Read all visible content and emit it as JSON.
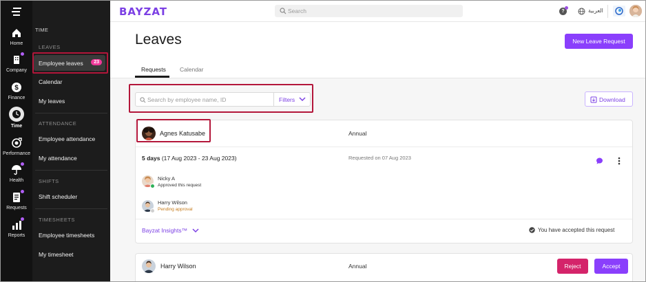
{
  "brand": {
    "logo": "BAYZAT",
    "accent": "#8a3ffc",
    "highlight": "#b3163a"
  },
  "topbar": {
    "search_placeholder": "Search",
    "help_label": "?",
    "language_label": "العربية",
    "icons": [
      "menu-icon",
      "search-icon",
      "help-icon",
      "globe-icon",
      "company-logo",
      "user-avatar"
    ]
  },
  "rail": {
    "items": [
      {
        "label": "Home",
        "icon": "home-icon"
      },
      {
        "label": "Company",
        "icon": "building-icon"
      },
      {
        "label": "Finance",
        "icon": "dollar-icon"
      },
      {
        "label": "Time",
        "icon": "clock-icon"
      },
      {
        "label": "Performance",
        "icon": "target-icon"
      },
      {
        "label": "Health",
        "icon": "umbrella-icon"
      },
      {
        "label": "Requests",
        "icon": "document-icon"
      },
      {
        "label": "Reports",
        "icon": "chart-icon"
      }
    ]
  },
  "sidebar": {
    "title": "TIME",
    "sections": [
      {
        "heading": "LEAVES",
        "items": [
          "Employee leaves",
          "Calendar",
          "My leaves"
        ]
      },
      {
        "heading": "ATTENDANCE",
        "items": [
          "Employee attendance",
          "My attendance"
        ]
      },
      {
        "heading": "SHIFTS",
        "items": [
          "Shift scheduler"
        ]
      },
      {
        "heading": "TIMESHEETS",
        "items": [
          "Employee timesheets",
          "My timesheet"
        ]
      }
    ],
    "badge_count": "23"
  },
  "main": {
    "title": "Leaves",
    "new_button": "New Leave Request",
    "tabs": [
      "Requests",
      "Calendar"
    ],
    "filter_placeholder": "Search by employee name, ID",
    "filters_label": "Filters",
    "download_label": "Download"
  },
  "requests": [
    {
      "employee": "Agnes Katusabe",
      "leave_type": "Annual",
      "days_bold": "5 days",
      "days_range": " (17 Aug 2023 - 23 Aug 2023)",
      "requested_on": "Requested on 07 Aug 2023",
      "approvers": [
        {
          "name": "Nicky A",
          "status": "Approved this request",
          "status_color": "#333333"
        },
        {
          "name": "Harry Wilson",
          "status": "Pending approval",
          "status_color": "#c57a1a"
        }
      ],
      "insights_label": "Bayzat Insights™",
      "accepted_text": "You have accepted this request"
    },
    {
      "employee": "Harry Wilson",
      "leave_type": "Annual",
      "reject_label": "Reject",
      "accept_label": "Accept"
    }
  ]
}
